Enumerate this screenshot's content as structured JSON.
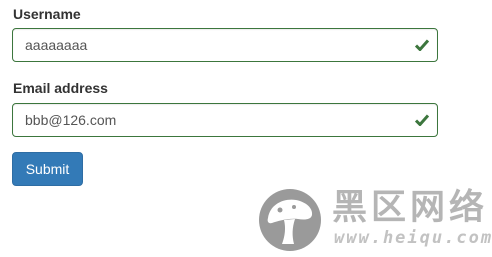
{
  "form": {
    "username": {
      "label": "Username",
      "value": "aaaaaaaa",
      "status_icon": "check-icon"
    },
    "email": {
      "label": "Email address",
      "value": "bbb@126.com",
      "status_icon": "check-icon"
    },
    "submit_label": "Submit"
  },
  "watermark": {
    "name_cn": "黑区网络",
    "url": "www.heiqu.com",
    "logo_icon": "mushroom-logo-icon"
  },
  "colors": {
    "success_border": "#3c763d",
    "success_icon": "#3c763d",
    "primary_button": "#337ab7",
    "label_text": "#333333",
    "input_text": "#555555",
    "watermark_gray": "#b5b5b5"
  }
}
